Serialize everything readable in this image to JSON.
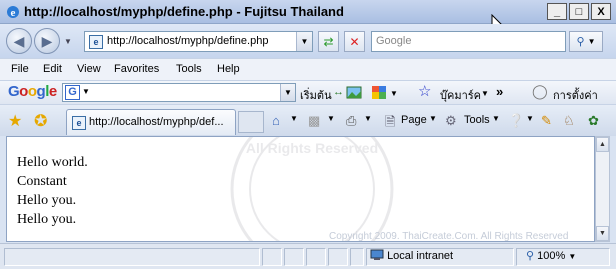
{
  "window": {
    "title": "http://localhost/myphp/define.php - Fujitsu Thailand",
    "minimize": "_",
    "maximize": "□",
    "close": "X"
  },
  "address_bar": {
    "url": "http://localhost/myphp/define.php",
    "search_placeholder": "Google"
  },
  "menu": [
    "File",
    "Edit",
    "View",
    "Favorites",
    "Tools",
    "Help"
  ],
  "google_toolbar": {
    "logo": "Google",
    "start_label": "เริ่มต้น",
    "bookmarks_label": "บุ๊คมาร์ค",
    "more_label": "»",
    "settings_label": "การตั้งค่า"
  },
  "tab": {
    "label": "http://localhost/myphp/def..."
  },
  "commands": {
    "page_label": "Page",
    "tools_label": "Tools"
  },
  "content": {
    "lines": [
      "Hello world.",
      "Constant",
      "Hello you.",
      "Hello you."
    ],
    "copyright": "Copyright 2009. ThaiCreate.Com. All Rights Reserved"
  },
  "status_bar": {
    "zone": "Local intranet",
    "zoom": "100%"
  }
}
